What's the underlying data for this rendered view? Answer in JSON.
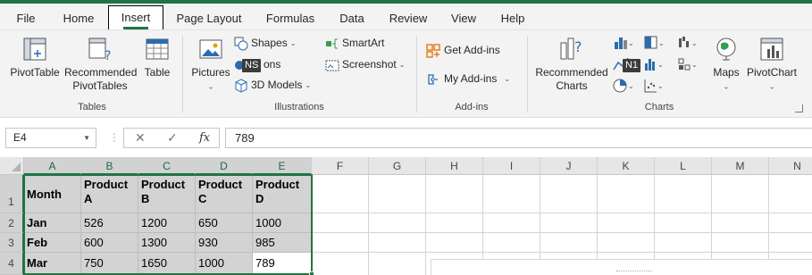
{
  "tabs": [
    "File",
    "Home",
    "Insert",
    "Page Layout",
    "Formulas",
    "Data",
    "Review",
    "View",
    "Help"
  ],
  "active_tab": "Insert",
  "ribbon": {
    "tables": {
      "pivot_table": "PivotTable",
      "rec_pivot_1": "Recommended",
      "rec_pivot_2": "PivotTables",
      "table": "Table",
      "label": "Tables"
    },
    "illustrations": {
      "pictures": "Pictures",
      "shapes": "Shapes",
      "icons_partial": "ons",
      "models_3d": "3D Models",
      "smartart": "SmartArt",
      "screenshot": "Screenshot",
      "label": "Illustrations"
    },
    "addins": {
      "get": "Get Add-ins",
      "my": "My Add-ins",
      "label": "Add-ins"
    },
    "charts": {
      "rec_1": "Recommended",
      "rec_2": "Charts",
      "maps": "Maps",
      "pivot_chart": "PivotChart",
      "label": "Charts"
    },
    "keytips": {
      "ns": "NS",
      "n1": "N1"
    }
  },
  "formula_bar": {
    "name_box": "E4",
    "formula": "789",
    "fx": "fx",
    "cancel": "✕",
    "enter": "✓"
  },
  "grid": {
    "columns": [
      "A",
      "B",
      "C",
      "D",
      "E",
      "F",
      "G",
      "H",
      "I",
      "J",
      "K",
      "L",
      "M",
      "N"
    ],
    "row_numbers": [
      "1",
      "2",
      "3",
      "4"
    ],
    "header_row": [
      "Month",
      "Product A",
      "Product B",
      "Product C",
      "Product D"
    ],
    "header_split": [
      [
        "Month",
        ""
      ],
      [
        "Product",
        "A"
      ],
      [
        "Product",
        "B"
      ],
      [
        "Product",
        "C"
      ],
      [
        "Product",
        "D"
      ]
    ],
    "rows": [
      [
        "Jan",
        "526",
        "1200",
        "650",
        "1000"
      ],
      [
        "Feb",
        "600",
        "1300",
        "930",
        "985"
      ],
      [
        "Mar",
        "750",
        "1650",
        "1000",
        "789"
      ]
    ],
    "active_cell": "E4"
  },
  "colors": {
    "accent": "#217346",
    "selection_fill": "#d3d3d3"
  }
}
